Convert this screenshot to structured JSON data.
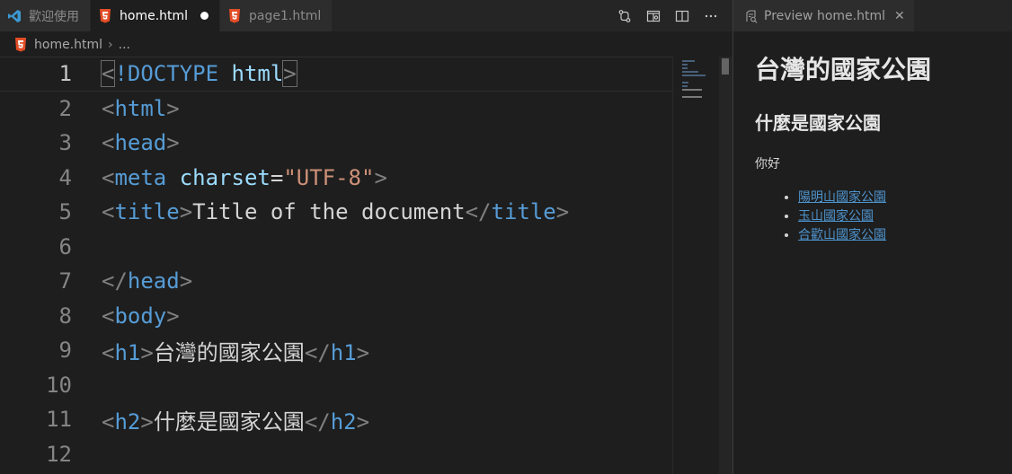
{
  "tabs": [
    {
      "label": "歡迎使用",
      "icon": "vscode-logo-icon",
      "active": false
    },
    {
      "label": "home.html",
      "icon": "html5-icon",
      "active": true,
      "dirty": true
    },
    {
      "label": "page1.html",
      "icon": "html5-icon",
      "active": false
    }
  ],
  "breadcrumb": {
    "file": "home.html",
    "more": "..."
  },
  "editor": {
    "lines": [
      {
        "n": "1"
      },
      {
        "n": "2"
      },
      {
        "n": "3"
      },
      {
        "n": "4"
      },
      {
        "n": "5"
      },
      {
        "n": "6"
      },
      {
        "n": "7"
      },
      {
        "n": "8"
      },
      {
        "n": "9"
      },
      {
        "n": "10"
      },
      {
        "n": "11"
      },
      {
        "n": "12"
      }
    ],
    "code": {
      "l1": {
        "lt": "<",
        "doctype": "!DOCTYPE",
        "html": "html",
        "gt": ">"
      },
      "l2": {
        "lt": "<",
        "tag": "html",
        "gt": ">"
      },
      "l3": {
        "lt": "<",
        "tag": "head",
        "gt": ">"
      },
      "l4": {
        "lt": "<",
        "tag": "meta",
        "attr": "charset",
        "eq": "=",
        "val": "\"UTF-8\"",
        "gt": ">"
      },
      "l5": {
        "lt": "<",
        "tag": "title",
        "gt": ">",
        "text": "Title of the document",
        "clt": "</",
        "ctag": "title",
        "cgt": ">"
      },
      "l7": {
        "clt": "</",
        "tag": "head",
        "gt": ">"
      },
      "l8": {
        "lt": "<",
        "tag": "body",
        "gt": ">"
      },
      "l9": {
        "lt": "<",
        "tag": "h1",
        "gt": ">",
        "text": "台灣的國家公園",
        "clt": "</",
        "ctag": "h1",
        "cgt": ">"
      },
      "l11": {
        "lt": "<",
        "tag": "h2",
        "gt": ">",
        "text": "什麼是國家公園",
        "clt": "</",
        "ctag": "h2",
        "cgt": ">"
      }
    }
  },
  "preview": {
    "tab_label": "Preview home.html",
    "h1": "台灣的國家公園",
    "h2": "什麼是國家公園",
    "p": "你好",
    "links": [
      "陽明山國家公園",
      "玉山國家公園",
      "合歡山國家公園"
    ]
  },
  "colors": {
    "accent_vscode": "#3c99d4",
    "html5": "#e44d26",
    "link": "#4e94ce"
  }
}
